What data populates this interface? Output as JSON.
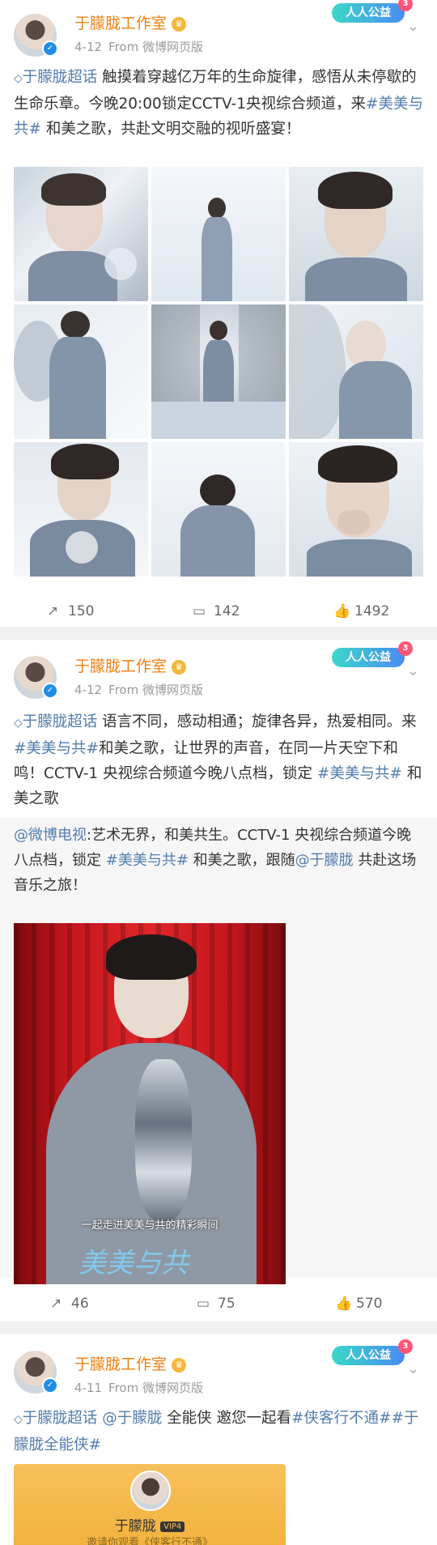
{
  "post1": {
    "author": "于朦胧工作室",
    "date": "4-12",
    "source": "From 微博网页版",
    "badge": "人人公益",
    "super_topic": "于朦胧超话",
    "text_part1": " 触摸着穿越亿万年的生命旋律，感悟从未停歇的生命乐章。今晚20:00锁定CCTV-1央视综合频道，来",
    "hashtag": "#美美与共#",
    "text_part2": " 和美之歌，共赴文明交融的视听盛宴！",
    "reposts": "150",
    "comments": "142",
    "likes": "1492"
  },
  "post2": {
    "author": "于朦胧工作室",
    "date": "4-12",
    "source": "From 微博网页版",
    "badge": "人人公益",
    "super_topic": "于朦胧超话",
    "text_part1": " 语言不同，感动相通；旋律各异，热爱相同。来",
    "hashtag1": "#美美与共#",
    "text_part2": "和美之歌，让世界的声音，在同一片天空下和鸣！CCTV-1 央视综合频道今晚八点档，锁定 ",
    "hashtag2": "#美美与共#",
    "text_part3": " 和美之歌",
    "repost_author": "@微博电视",
    "repost_part1": ":艺术无界，和美共生。CCTV-1 央视综合频道今晚八点档，锁定 ",
    "repost_hashtag": "#美美与共#",
    "repost_part2": " 和美之歌，跟随",
    "repost_mention": "@于朦胧",
    "repost_part3": " 共赴这场音乐之旅！",
    "video_caption": "一起走进美美与共的精彩瞬间",
    "video_logo": "美美与共",
    "reposts": "46",
    "comments": "75",
    "likes": "570"
  },
  "post3": {
    "author": "于朦胧工作室",
    "date": "4-11",
    "source": "From 微博网页版",
    "badge": "人人公益",
    "super_topic": "于朦胧超话",
    "mention": "@于朦胧",
    "text_part1": " 全能侠 邀您一起看",
    "hashtag1": "#侠客行不通#",
    "hashtag2": "#于朦胧全能侠#",
    "card_name": "于朦胧",
    "card_vip": "VIP4",
    "card_sub": "邀请你观看《侠客行不通》"
  },
  "colors": {
    "name": "#ef7f10",
    "link": "#eb7350",
    "topic": "#507daf"
  },
  "icons": {
    "repost": "repost-icon",
    "comment": "comment-icon",
    "like": "like-icon",
    "verified": "verified-icon",
    "crown": "crown-icon",
    "chevron": "chevron-down-icon"
  }
}
